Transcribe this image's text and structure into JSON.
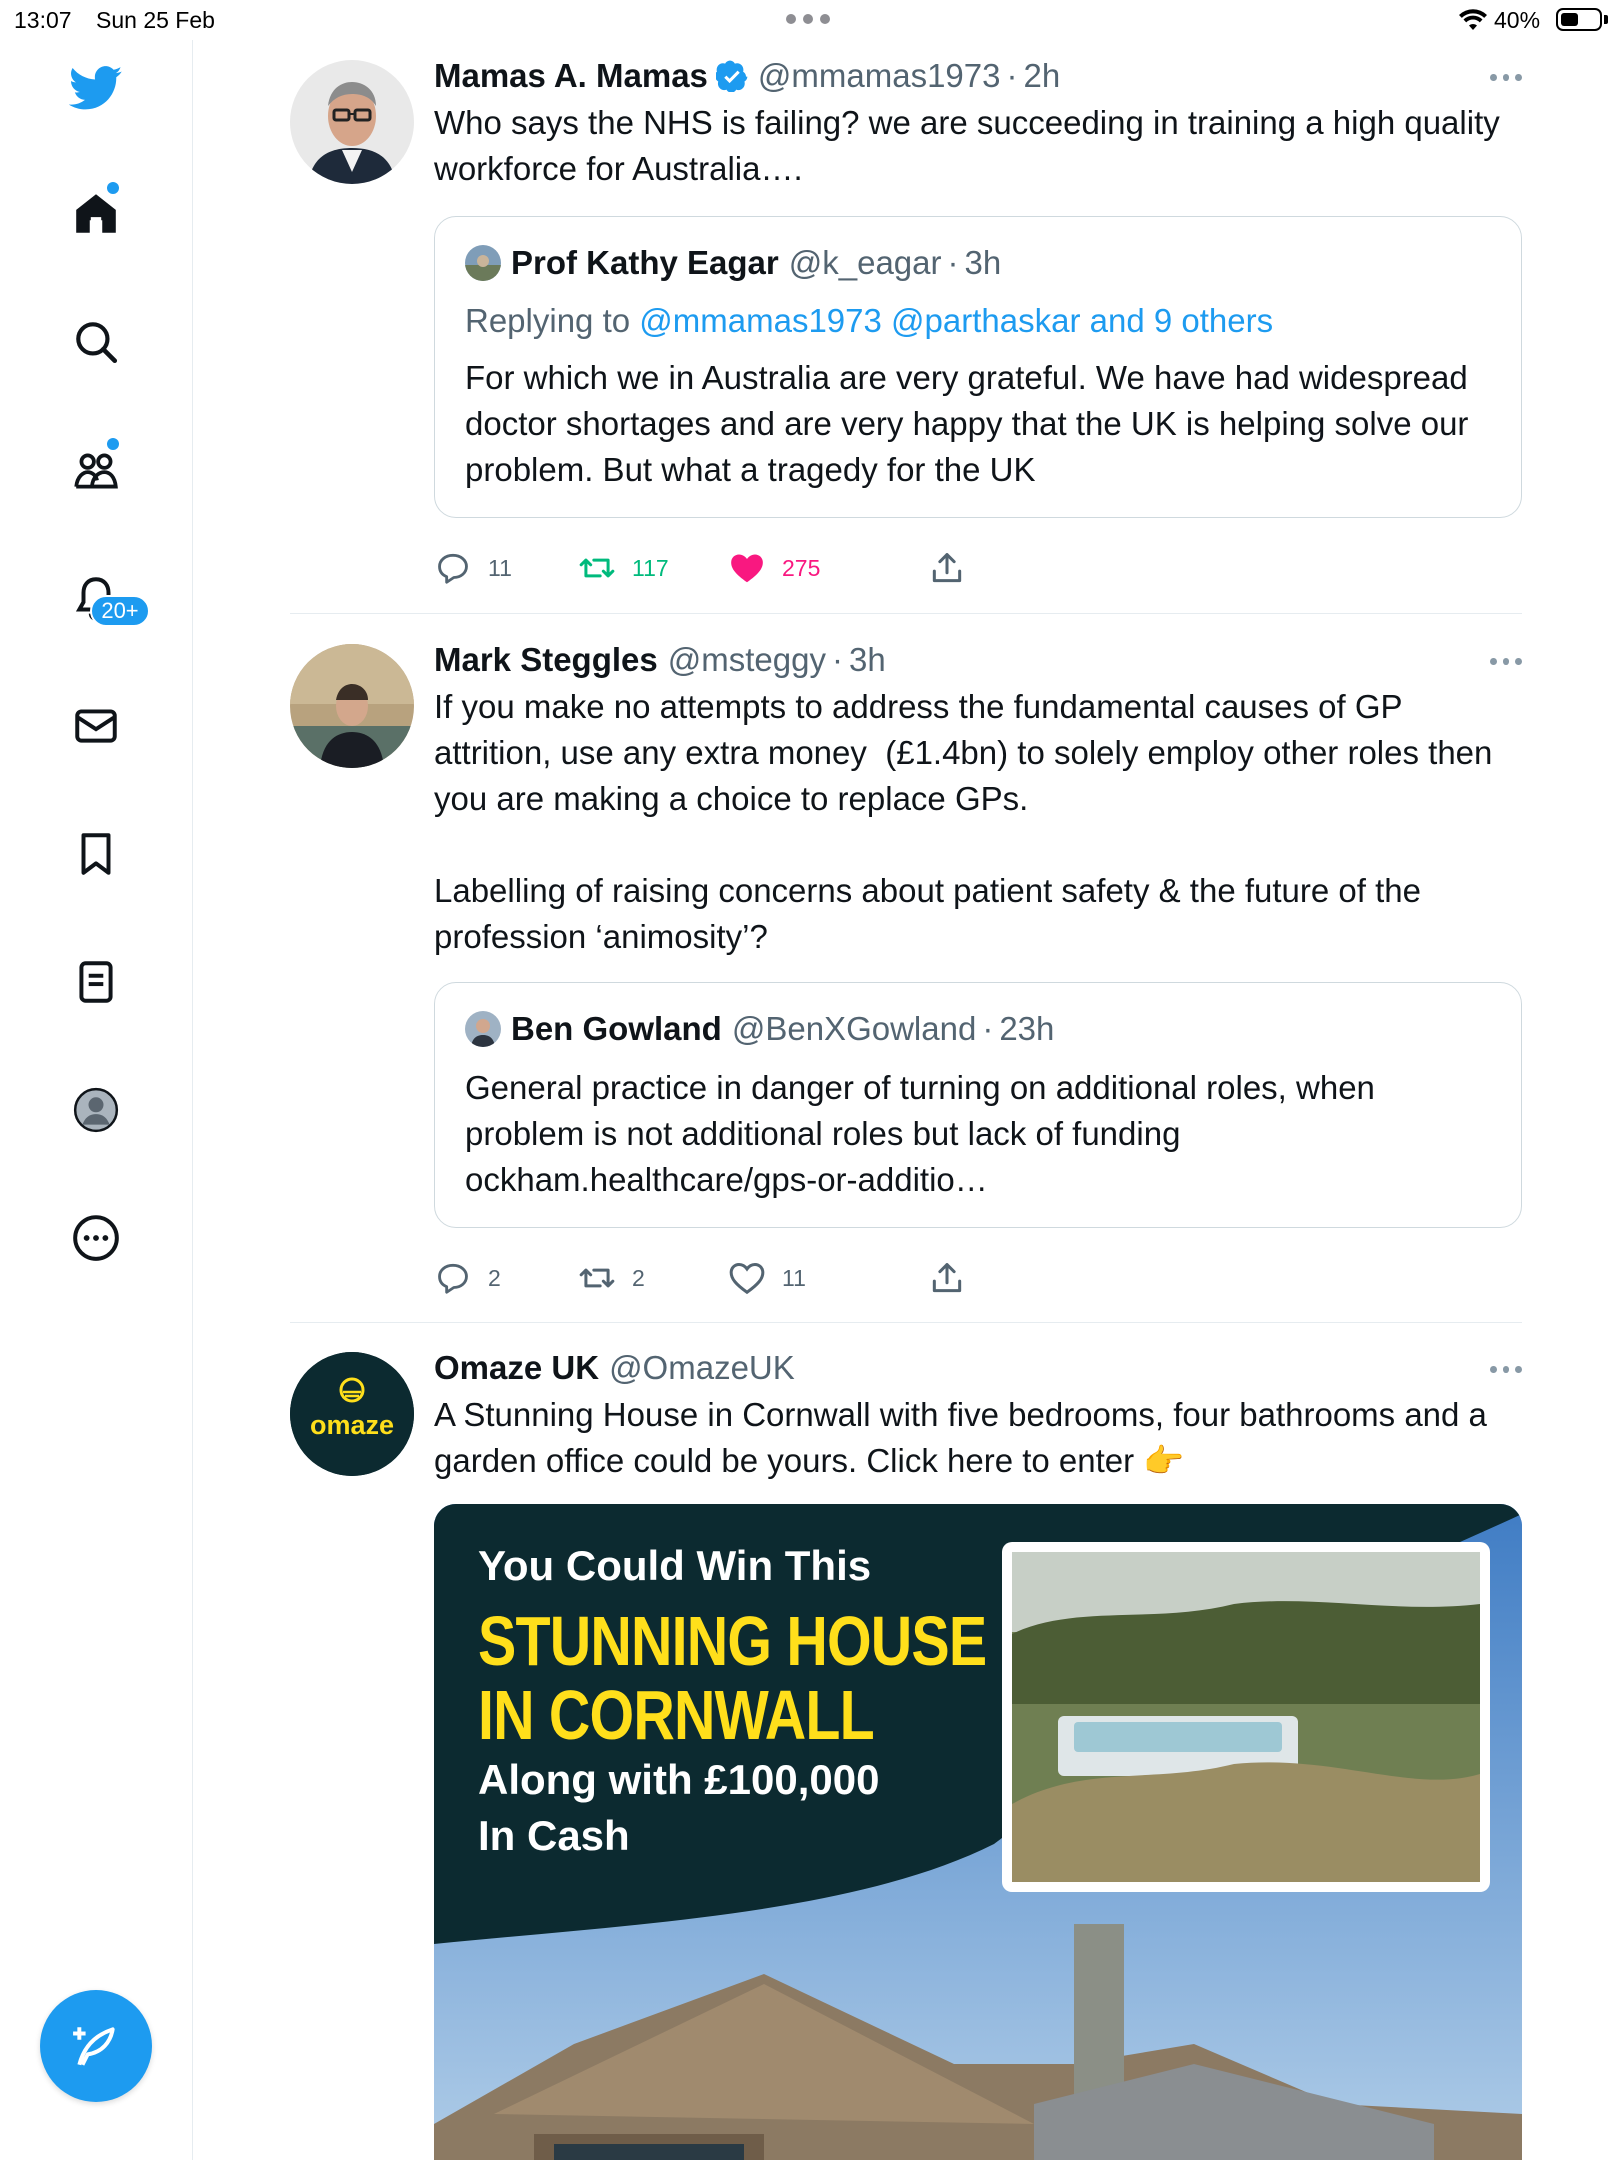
{
  "status_bar": {
    "time": "13:07",
    "date": "Sun 25 Feb",
    "battery": "40%"
  },
  "sidebar": {
    "notifications_badge": "20+",
    "items": [
      "twitter-logo",
      "home",
      "search",
      "communities",
      "notifications",
      "messages",
      "bookmarks",
      "lists",
      "profile",
      "more"
    ]
  },
  "tweets": [
    {
      "name": "Mamas A. Mamas",
      "handle": "@mmamas1973",
      "time": "2h",
      "text": "Who says the NHS is failing? we are succeeding in training a high quality workforce for Australia….",
      "quote": {
        "name": "Prof Kathy Eagar",
        "handle": "@k_eagar",
        "time": "3h",
        "replying_label": "Replying to",
        "replying_to": "@mmamas1973 @parthaskar and 9 others",
        "text": "For which we in Australia are very grateful. We have had widespread doctor shortages and are very happy that the UK is helping solve our problem. But what a tragedy for the UK"
      },
      "replies": "11",
      "retweets": "117",
      "likes": "275"
    },
    {
      "name": "Mark Steggles",
      "handle": "@msteggy",
      "time": "3h",
      "text": "If you make no attempts to address the fundamental causes of GP attrition, use any extra money  (£1.4bn) to solely employ other roles then you are making a choice to replace GPs.\n\nLabelling of raising concerns about patient safety & the future of the profession ‘animosity’?",
      "quote": {
        "name": "Ben Gowland",
        "handle": "@BenXGowland",
        "time": "23h",
        "text": "General practice in danger of turning on additional roles, when problem is not additional roles but lack of funding ockham.healthcare/gps-or-additio…"
      },
      "replies": "2",
      "retweets": "2",
      "likes": "11"
    },
    {
      "name": "Omaze UK",
      "handle": "@OmazeUK",
      "text": "A Stunning House in Cornwall with five bedrooms, four bathrooms and a garden office could be yours. Click here to enter 👉",
      "avatar_label": "omaze",
      "ad": {
        "line1": "You Could Win This",
        "line2": "STUNNING HOUSE",
        "line3": "IN CORNWALL",
        "line4": "Along with £100,000",
        "line5": "In Cash"
      }
    }
  ],
  "colors": {
    "accent": "#1d9bf0",
    "retweet": "#00ba7c",
    "like": "#f91880",
    "ad_dark": "#0c2a30",
    "ad_yellow": "#ffdf1b"
  }
}
